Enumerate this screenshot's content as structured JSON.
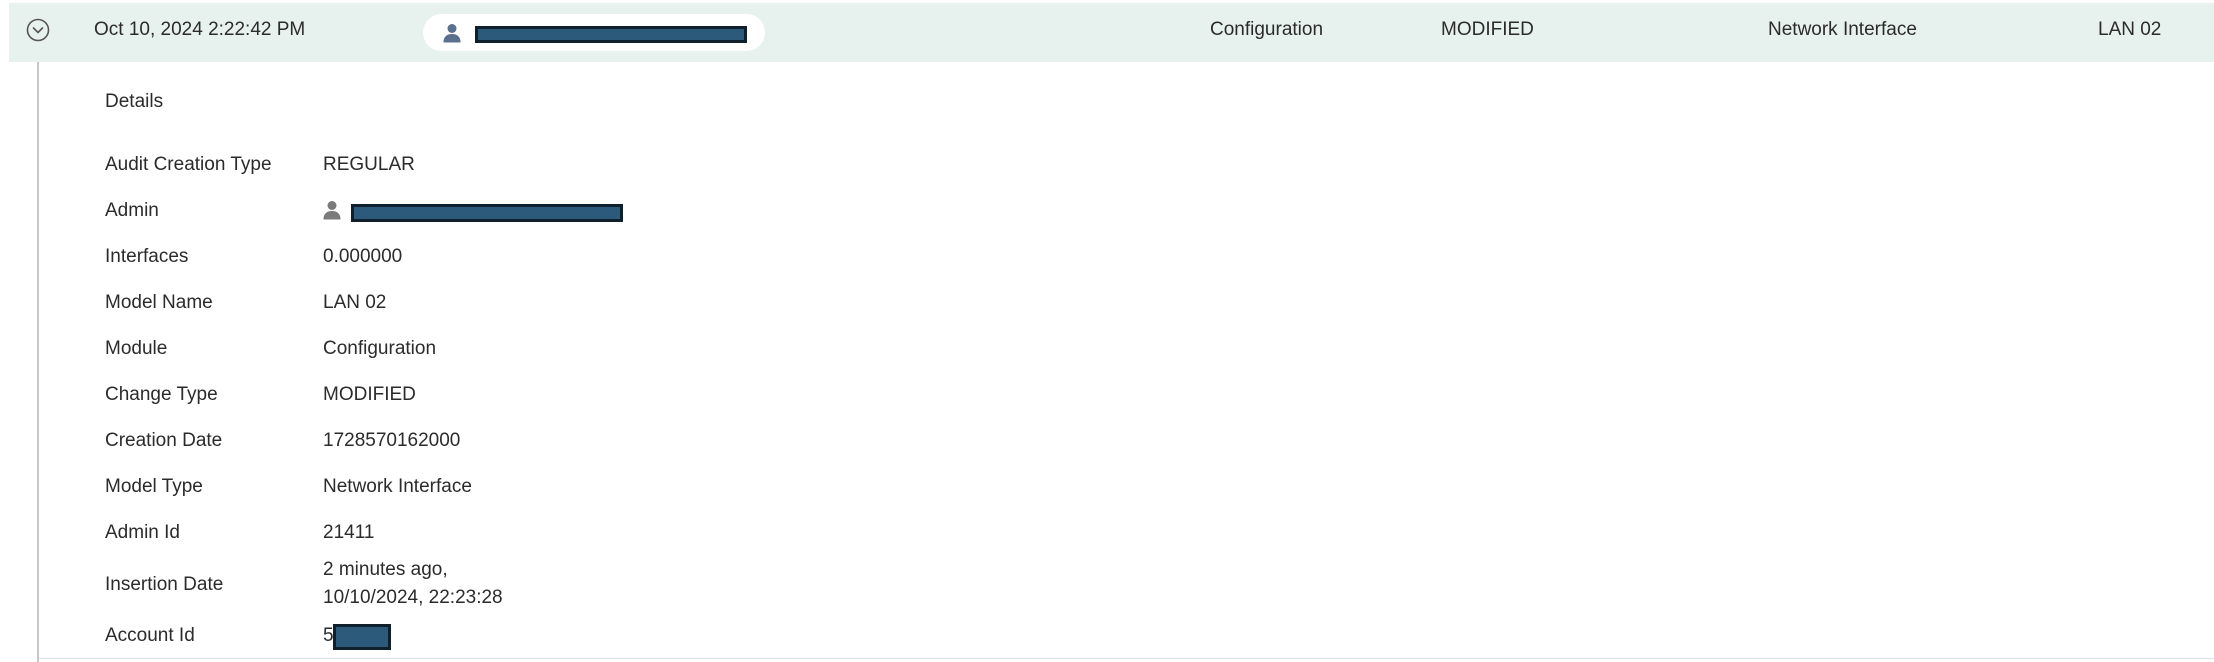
{
  "row": {
    "timestamp": "Oct 10, 2024 2:22:42 PM",
    "module": "Configuration",
    "change_type": "MODIFIED",
    "model_type": "Network Interface",
    "model_name": "LAN 02"
  },
  "details": {
    "title": "Details",
    "fields": [
      {
        "label": "Audit Creation Type",
        "value": "REGULAR"
      },
      {
        "label": "Admin",
        "value": ""
      },
      {
        "label": "Interfaces",
        "value": "0.000000"
      },
      {
        "label": "Model Name",
        "value": "LAN 02"
      },
      {
        "label": "Module",
        "value": "Configuration"
      },
      {
        "label": "Change Type",
        "value": "MODIFIED"
      },
      {
        "label": "Creation Date",
        "value": "1728570162000"
      },
      {
        "label": "Model Type",
        "value": "Network Interface"
      },
      {
        "label": "Admin Id",
        "value": "21411"
      },
      {
        "label": "Insertion Date",
        "value_line1": "2 minutes ago,",
        "value_line2": "10/10/2024, 22:23:28"
      },
      {
        "label": "Account Id",
        "value": "5"
      }
    ]
  },
  "icons": {
    "expand": "chevron-circle-down-icon",
    "user": "person-icon"
  },
  "colors": {
    "row_highlight": "#e7f2ee",
    "redaction": "#2c5a7a",
    "icon_blue": "#5b6f8f",
    "icon_gray": "#7a7a7a"
  }
}
